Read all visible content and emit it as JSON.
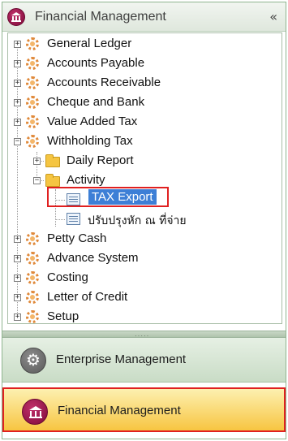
{
  "header": {
    "title": "Financial Management",
    "collapse_glyph": "«",
    "icon": "bank-icon"
  },
  "tree": {
    "items": [
      {
        "label": "General Ledger",
        "icon": "gear-icon",
        "expander": "+"
      },
      {
        "label": "Accounts Payable",
        "icon": "gear-icon",
        "expander": "+"
      },
      {
        "label": "Accounts Receivable",
        "icon": "gear-icon",
        "expander": "+"
      },
      {
        "label": "Cheque and Bank",
        "icon": "gear-icon",
        "expander": "+"
      },
      {
        "label": "Value Added Tax",
        "icon": "gear-icon",
        "expander": "+"
      },
      {
        "label": "Withholding Tax",
        "icon": "gear-icon",
        "expander": "−"
      },
      {
        "label": "Daily Report",
        "icon": "folder-icon",
        "expander": "+"
      },
      {
        "label": "Activity",
        "icon": "folder-icon",
        "expander": "−"
      },
      {
        "label": "TAX Export",
        "icon": "document-icon",
        "selected": true
      },
      {
        "label": "ปรับปรุงหัก ณ ที่จ่าย",
        "icon": "document-icon"
      },
      {
        "label": "Petty Cash",
        "icon": "gear-icon",
        "expander": "+"
      },
      {
        "label": "Advance System",
        "icon": "gear-icon",
        "expander": "+"
      },
      {
        "label": "Costing",
        "icon": "gear-icon",
        "expander": "+"
      },
      {
        "label": "Letter of Credit",
        "icon": "gear-icon",
        "expander": "+"
      },
      {
        "label": "Setup",
        "icon": "gear-icon",
        "expander": "+"
      }
    ]
  },
  "splitter": {
    "grip": "·····"
  },
  "modules": [
    {
      "label": "Enterprise Management",
      "icon": "gear-icon"
    },
    {
      "label": "Financial Management",
      "icon": "bank-icon",
      "active": true
    }
  ],
  "colors": {
    "selection": "#3d7fd6",
    "highlight_border": "#e02020",
    "active_module": "#f7c541"
  }
}
